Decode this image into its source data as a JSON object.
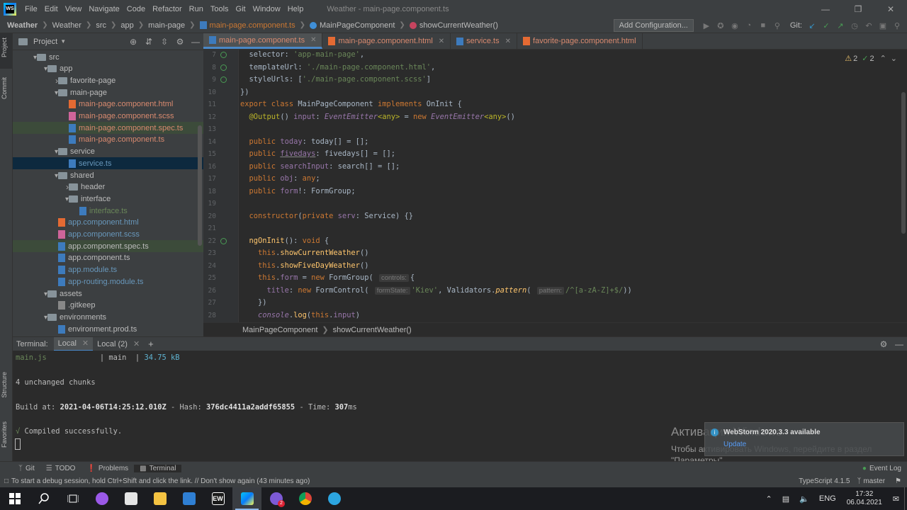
{
  "menu": {
    "items": [
      "File",
      "Edit",
      "View",
      "Navigate",
      "Code",
      "Refactor",
      "Run",
      "Tools",
      "Git",
      "Window",
      "Help"
    ],
    "window_title": "Weather - main-page.component.ts"
  },
  "navbar": {
    "crumbs": [
      "Weather",
      "Weather",
      "src",
      "app",
      "main-page"
    ],
    "file": "main-page.component.ts",
    "class": "MainPageComponent",
    "method": "showCurrentWeather()",
    "add_config": "Add Configuration...",
    "git_label": "Git:"
  },
  "left_strip": {
    "project": "Project",
    "commit": "Commit",
    "structure": "Structure",
    "favorites": "Favorites"
  },
  "project": {
    "title": "Project",
    "nodes": [
      {
        "label": "src",
        "type": "folder",
        "depth": 0,
        "open": true,
        "color": "def"
      },
      {
        "label": "app",
        "type": "folder",
        "depth": 1,
        "open": true,
        "color": "def"
      },
      {
        "label": "favorite-page",
        "type": "folder",
        "depth": 2,
        "open": false,
        "color": "def"
      },
      {
        "label": "main-page",
        "type": "folder",
        "depth": 2,
        "open": true,
        "color": "def"
      },
      {
        "label": "main-page.component.html",
        "type": "html",
        "depth": 3,
        "color": "red"
      },
      {
        "label": "main-page.component.scss",
        "type": "scss",
        "depth": 3,
        "color": "red"
      },
      {
        "label": "main-page.component.spec.ts",
        "type": "ts",
        "depth": 3,
        "color": "red",
        "hl": true
      },
      {
        "label": "main-page.component.ts",
        "type": "ts",
        "depth": 3,
        "color": "red"
      },
      {
        "label": "service",
        "type": "folder",
        "depth": 2,
        "open": true,
        "color": "def"
      },
      {
        "label": "service.ts",
        "type": "ts",
        "depth": 3,
        "color": "blue",
        "sel": true
      },
      {
        "label": "shared",
        "type": "folder",
        "depth": 2,
        "open": true,
        "color": "def"
      },
      {
        "label": "header",
        "type": "folder",
        "depth": 3,
        "open": false,
        "color": "def"
      },
      {
        "label": "interface",
        "type": "folder",
        "depth": 3,
        "open": true,
        "color": "def"
      },
      {
        "label": "interface.ts",
        "type": "ts",
        "depth": 4,
        "color": "green"
      },
      {
        "label": "app.component.html",
        "type": "html",
        "depth": 2,
        "color": "blue"
      },
      {
        "label": "app.component.scss",
        "type": "scss",
        "depth": 2,
        "color": "blue"
      },
      {
        "label": "app.component.spec.ts",
        "type": "ts",
        "depth": 2,
        "color": "def",
        "hl": true
      },
      {
        "label": "app.component.ts",
        "type": "ts",
        "depth": 2,
        "color": "def"
      },
      {
        "label": "app.module.ts",
        "type": "ts",
        "depth": 2,
        "color": "blue"
      },
      {
        "label": "app-routing.module.ts",
        "type": "ts",
        "depth": 2,
        "color": "blue"
      },
      {
        "label": "assets",
        "type": "folder",
        "depth": 1,
        "open": true,
        "color": "def"
      },
      {
        "label": ".gitkeep",
        "type": "git",
        "depth": 2,
        "color": "def"
      },
      {
        "label": "environments",
        "type": "folder",
        "depth": 1,
        "open": true,
        "color": "def"
      },
      {
        "label": "environment.prod.ts",
        "type": "ts",
        "depth": 2,
        "color": "def"
      }
    ]
  },
  "tabs": [
    {
      "label": "main-page.component.ts",
      "active": true
    },
    {
      "label": "main-page.component.html",
      "active": false
    },
    {
      "label": "service.ts",
      "active": false
    },
    {
      "label": "favorite-page.component.html",
      "active": false
    }
  ],
  "editor": {
    "warnings": "2",
    "ok": "2",
    "line_numbers": [
      "7",
      "8",
      "9",
      "10",
      "11",
      "12",
      "13",
      "14",
      "15",
      "16",
      "17",
      "18",
      "19",
      "20",
      "21",
      "22",
      "23",
      "24",
      "25",
      "26",
      "27",
      "28"
    ],
    "hints": {
      "controls": "controls:",
      "formState": "formState:",
      "pattern": "pattern:"
    },
    "strings": {
      "selector": "'app-main-page'",
      "templateUrl": "'./main-page.component.html'",
      "styleUrls": "'./main-page.component.scss'",
      "kiev": "'Kiev'"
    }
  },
  "breadcrumb_bottom": {
    "class": "MainPageComponent",
    "method": "showCurrentWeather()"
  },
  "terminal": {
    "label": "Terminal:",
    "tabs": [
      "Local",
      "Local (2)"
    ],
    "lines": {
      "main_js": "main.js",
      "main_sep": "| main  |",
      "size": "34.75 kB",
      "unchanged": "4 unchanged chunks",
      "build_prefix": "Build at:",
      "build_date": "2021-04-06T14:25:12.010Z",
      "hash_label": "- Hash:",
      "hash": "376dc4411a2addf65855",
      "time_label": "- Time:",
      "time": "307",
      "time_unit": "ms",
      "compiled": "√ Compiled successfully."
    }
  },
  "activation": {
    "title": "Активация Windows",
    "line1": "Чтобы активировать Windows, перейдите в раздел",
    "line2": "\"Параметры\"."
  },
  "notification": {
    "title": "WebStorm 2020.3.3 available",
    "link": "Update"
  },
  "toolwindows": {
    "git": "Git",
    "todo": "TODO",
    "problems": "Problems",
    "terminal": "Terminal",
    "event_log": "Event Log"
  },
  "status": {
    "message": "To start a debug session, hold Ctrl+Shift and click the link. // Don't show again (43 minutes ago)",
    "typescript": "TypeScript 4.1.5",
    "branch": "master"
  },
  "taskbar": {
    "lang": "ENG",
    "time": "17:32",
    "date": "06.04.2021",
    "ew": "EW",
    "badge": "2"
  }
}
